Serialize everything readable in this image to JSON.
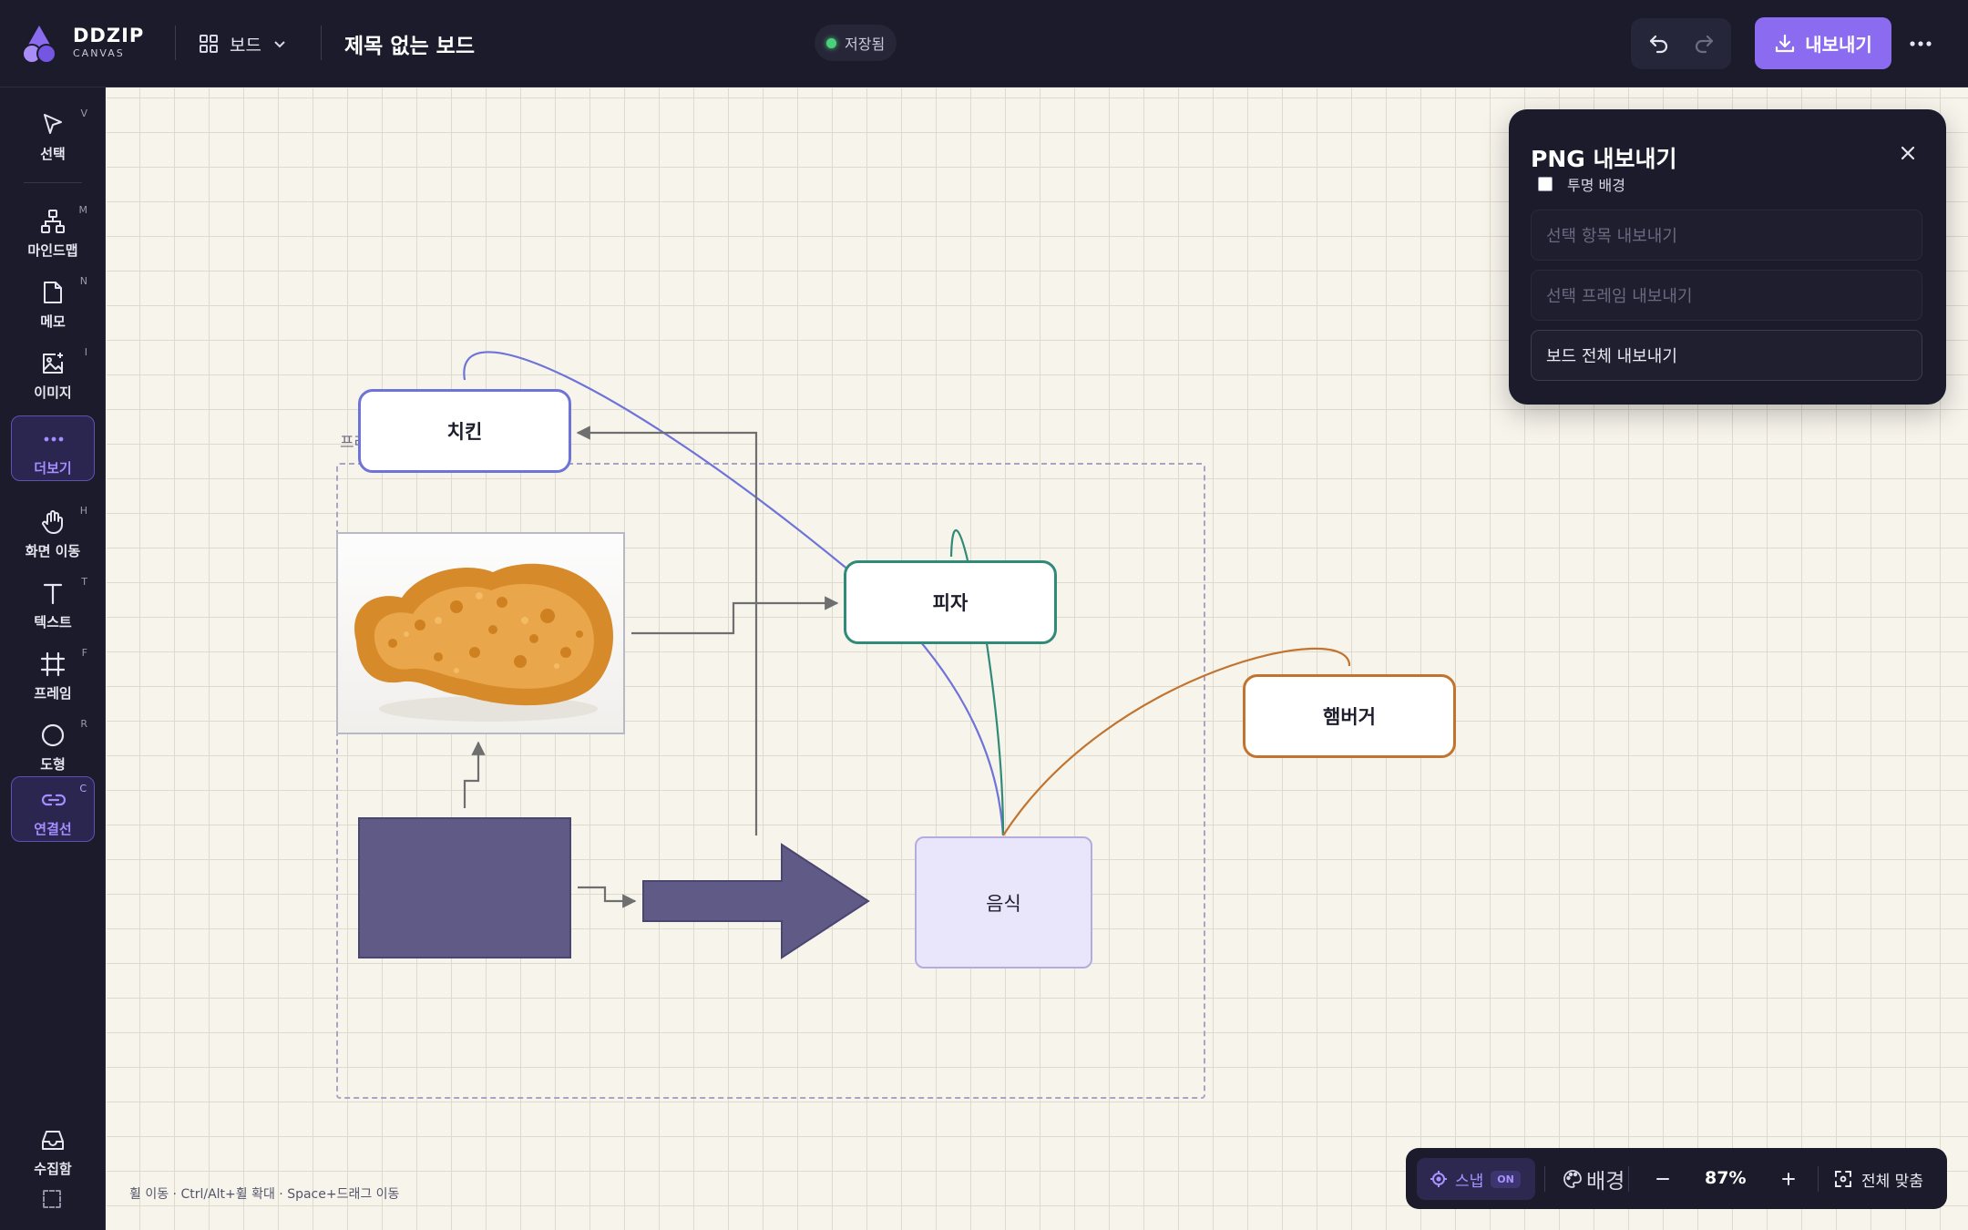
{
  "app": {
    "brand": "DDZIP",
    "brand_sub": "CANVAS",
    "board_menu": "보드",
    "doc_title": "제목 없는 보드",
    "status": "저장됨"
  },
  "toolbar": {
    "export_label": "내보내기"
  },
  "sidebar": {
    "tools": [
      {
        "label": "선택",
        "key": "V",
        "icon": "cursor-icon"
      },
      {
        "label": "마인드맵",
        "key": "M",
        "icon": "mindmap-icon"
      },
      {
        "label": "메모",
        "key": "N",
        "icon": "memo-icon"
      },
      {
        "label": "이미지",
        "key": "I",
        "icon": "image-icon"
      },
      {
        "label": "더보기",
        "key": "",
        "icon": "more-icon"
      },
      {
        "label": "화면 이동",
        "key": "H",
        "icon": "hand-icon"
      },
      {
        "label": "텍스트",
        "key": "T",
        "icon": "text-icon"
      },
      {
        "label": "프레임",
        "key": "F",
        "icon": "frame-icon"
      },
      {
        "label": "도형",
        "key": "R",
        "icon": "circle-icon"
      },
      {
        "label": "연결선",
        "key": "C",
        "icon": "link-icon"
      }
    ],
    "inbox_label": "수집함"
  },
  "canvas": {
    "frame_label": "프레임",
    "nodes": {
      "chicken": "치킨",
      "pizza": "피자",
      "burger": "햄버거",
      "food": "음식"
    },
    "hint": "휠 이동 · Ctrl/Alt+휠 확대 · Space+드래그 이동"
  },
  "export_panel": {
    "title": "PNG 내보내기",
    "transparent_label": "투명 배경",
    "transparent_checked": false,
    "options": [
      "선택 항목 내보내기",
      "선택 프레임 내보내기",
      "보드 전체 내보내기"
    ]
  },
  "bottom": {
    "snap_label": "스냅",
    "snap_state": "ON",
    "bg_label": "배경",
    "zoom": "87%",
    "fit_label": "전체 맞춤"
  },
  "colors": {
    "accent": "#8b6cf0",
    "chicken_border": "#6e73d8",
    "pizza_border": "#2f8a77",
    "burger_border": "#c2742e",
    "shape_fill": "#5f5a86"
  }
}
